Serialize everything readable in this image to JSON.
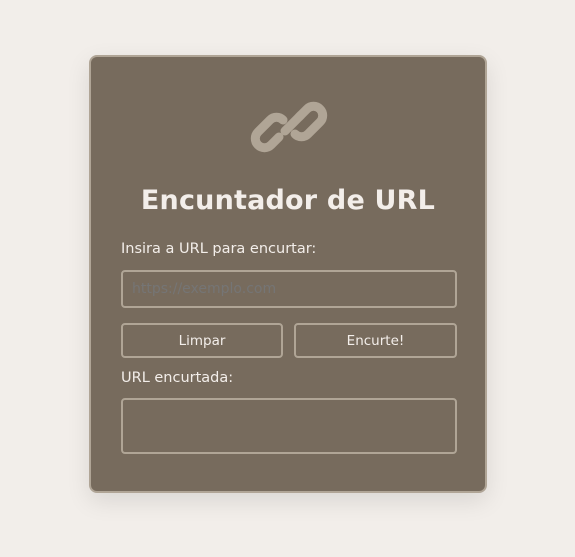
{
  "app": {
    "title": "Encuntador de URL",
    "logo_icon": "link-icon"
  },
  "form": {
    "input_label": "Insira a URL para encurtar:",
    "input_placeholder": "https://exemplo.com",
    "input_value": "",
    "clear_label": "Limpar",
    "shorten_label": "Encurte!",
    "output_label": "URL encurtada:",
    "output_value": ""
  },
  "colors": {
    "page_background": "#f2eeea",
    "card_background": "#776b5d",
    "border": "#b0a596",
    "text": "#f3eeea",
    "icon": "#b0a596"
  }
}
